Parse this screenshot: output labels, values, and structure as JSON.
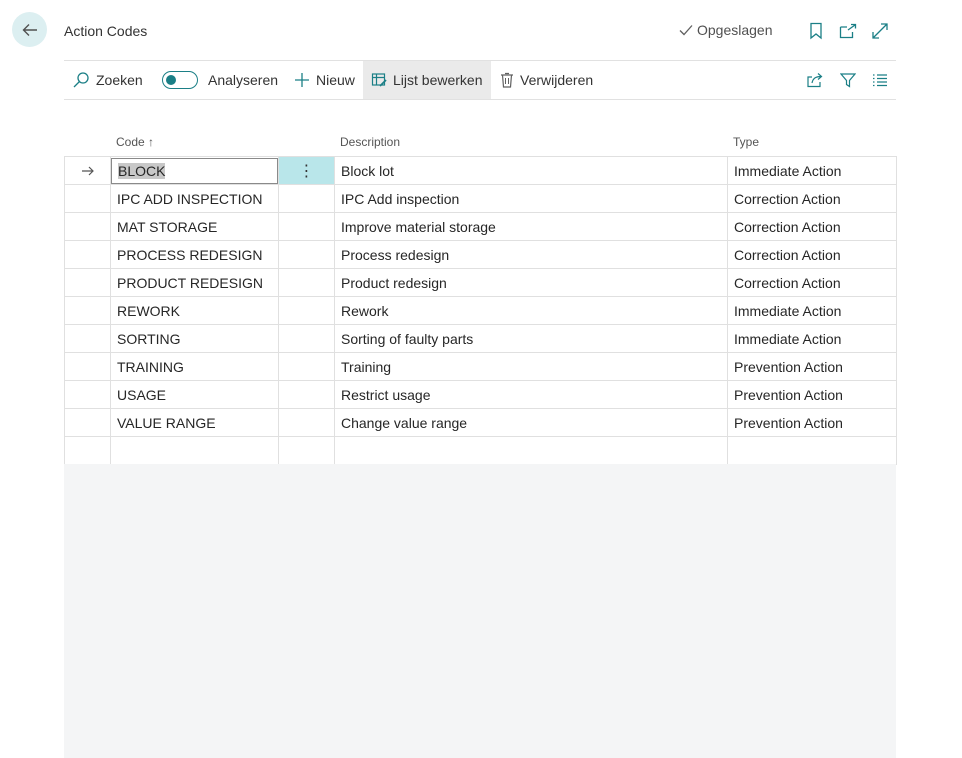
{
  "header": {
    "title": "Action Codes",
    "saved_label": "Opgeslagen"
  },
  "actions": {
    "search": "Zoeken",
    "analyze": "Analyseren",
    "new": "Nieuw",
    "edit_list": "Lijst bewerken",
    "delete": "Verwijderen"
  },
  "columns": {
    "code": "Code ↑",
    "description": "Description",
    "type": "Type"
  },
  "rows": [
    {
      "code": "BLOCK",
      "description": "Block lot",
      "type": "Immediate Action"
    },
    {
      "code": "IPC ADD INSPECTION",
      "description": "IPC Add inspection",
      "type": "Correction Action"
    },
    {
      "code": "MAT STORAGE",
      "description": "Improve material storage",
      "type": "Correction Action"
    },
    {
      "code": "PROCESS REDESIGN",
      "description": "Process redesign",
      "type": "Correction Action"
    },
    {
      "code": "PRODUCT REDESIGN",
      "description": "Product redesign",
      "type": "Correction Action"
    },
    {
      "code": "REWORK",
      "description": "Rework",
      "type": "Immediate Action"
    },
    {
      "code": "SORTING",
      "description": "Sorting of faulty parts",
      "type": "Immediate Action"
    },
    {
      "code": "TRAINING",
      "description": "Training",
      "type": "Prevention Action"
    },
    {
      "code": "USAGE",
      "description": "Restrict usage",
      "type": "Prevention Action"
    },
    {
      "code": "VALUE RANGE",
      "description": "Change value range",
      "type": "Prevention Action"
    }
  ],
  "colors": {
    "accent": "#1b7f86",
    "selected_cell": "#b9e6ea",
    "back_button": "#dceff1"
  }
}
